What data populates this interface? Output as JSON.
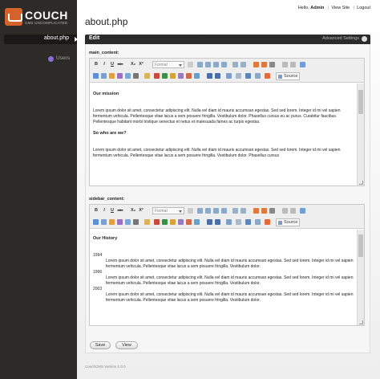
{
  "app": {
    "logo_word": "COUCH",
    "logo_tag": "CMS UNCOMPLICATED",
    "footer": "CouchCMS Version 1.0.0"
  },
  "sidebar": {
    "items": [
      {
        "label": "about.php",
        "active": true
      },
      {
        "label": "Users",
        "active": false
      }
    ]
  },
  "topbar": {
    "hello": "Hello,",
    "user": "Admin",
    "view_site": "View Site",
    "logout": "Logout"
  },
  "page": {
    "title": "about.php",
    "panel_title": "Edit",
    "advanced_settings": "Advanced Settings"
  },
  "toolbar": {
    "bold": "B",
    "italic": "I",
    "underline": "U",
    "strike": "abc",
    "subscript": "X₂",
    "superscript": "X²",
    "format_placeholder": "Format",
    "source": "Source"
  },
  "fields": {
    "main": {
      "label": "main_content:",
      "heading1": "Our mission",
      "para1": "Lorem ipsum dolor sit amet, consectetur adipiscing elit. Nulla vel diam id mauris accumsan egestas. Sed sed lorem. Integer id mi vel sapien fermentum vehicula. Pellentesque vitae lacus a sem posuere fringilla. Vestibulum dolor. Phasellus cursus eu ac purus. Curabitur faucibus. Pellentesque habitant morbi tristique senectus et netus et malesuada fames ac turpis egestas.",
      "heading2": "So who are we?",
      "para2": "Lorem ipsum dolor sit amet, consectetur adipiscing elit. Nulla vel diam id mauris accumsan egestas. Sed sed lorem. Integer id mi vel sapien fermentum vehicula. Pellentesque vitae lacus a sem posuere fringilla. Vestibulum dolor. Phasellus cursus"
    },
    "sidebar": {
      "label": "sidebar_content:",
      "heading": "Our History",
      "history": [
        {
          "year": "1994",
          "text": "Lorem ipsum dolor sit amet, consectetur adipiscing elit. Nulla vel diam id mauris accumsan egestas. Sed sed lorem. Integer id mi vel sapien fermentum vehicula. Pellentesque vitae lacus a sem posuere fringilla. Vestibulum dolor."
        },
        {
          "year": "1996",
          "text": "Lorem ipsum dolor sit amet, consectetur adipiscing elit. Nulla vel diam id mauris accumsan egestas. Sed sed lorem. Integer id mi vel sapien fermentum vehicula. Pellentesque vitae lacus a sem posuere fringilla. Vestibulum dolor."
        },
        {
          "year": "2003",
          "text": "Lorem ipsum dolor sit amet, consectetur adipiscing elit. Nulla vel diam id mauris accumsan egestas. Sed sed lorem. Integer id mi vel sapien fermentum vehicula. Pellentesque vitae lacus a sem posuere fringilla. Vestibulum dolor."
        }
      ]
    }
  },
  "buttons": {
    "save": "Save",
    "view": "View"
  },
  "colors": {
    "sidebar_bg": "#2d2b28",
    "logo_accent": "#d4622a",
    "panel_header": "#2b2b2b"
  }
}
